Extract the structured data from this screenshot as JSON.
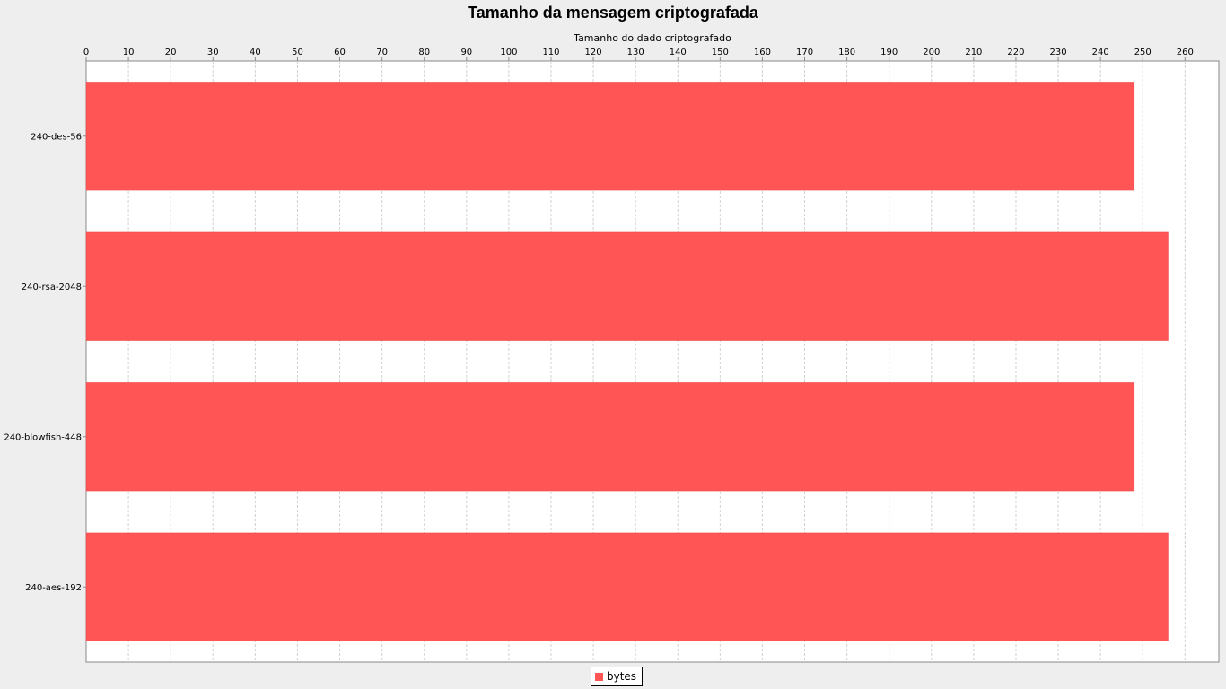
{
  "chart_data": {
    "type": "bar",
    "orientation": "horizontal",
    "title": "Tamanho da mensagem criptografada",
    "xlabel": "Tamanho do dado criptografado",
    "ylabel": "",
    "xlim": [
      0,
      268
    ],
    "x_ticks": [
      0,
      10,
      20,
      30,
      40,
      50,
      60,
      70,
      80,
      90,
      100,
      110,
      120,
      130,
      140,
      150,
      160,
      170,
      180,
      190,
      200,
      210,
      220,
      230,
      240,
      250,
      260
    ],
    "x_axis_position": "top",
    "categories": [
      "240-des-56",
      "240-rsa-2048",
      "240-blowfish-448",
      "240-aes-192"
    ],
    "series": [
      {
        "name": "bytes",
        "values": [
          248,
          256,
          248,
          256
        ],
        "color": "#ff5555"
      }
    ],
    "grid": true,
    "legend_position": "bottom-center"
  },
  "colors": {
    "background": "#eeeeee",
    "plot_background": "#ffffff",
    "bar_fill": "#ff5555",
    "bar_outline": "#e84a4a",
    "gridline": "#d0d0d0",
    "axis": "#888888",
    "text": "#000000"
  }
}
